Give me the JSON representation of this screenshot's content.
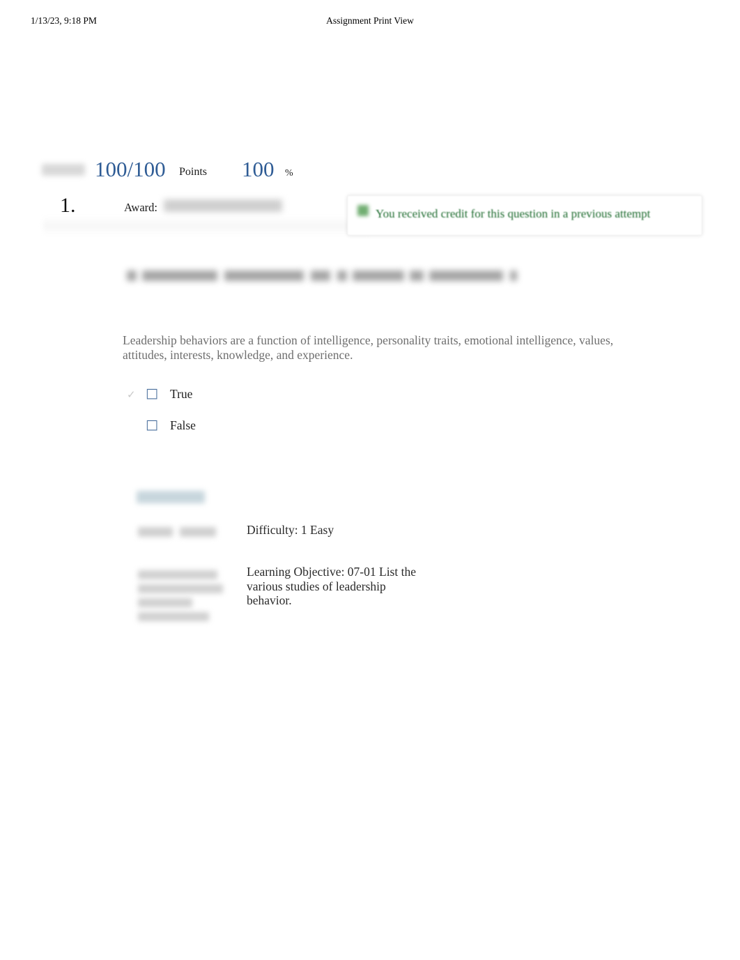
{
  "header": {
    "date": "1/13/23, 9:18 PM",
    "title": "Assignment Print View"
  },
  "score": {
    "points": "100/100",
    "points_label": "Points",
    "percent": "100",
    "percent_label": "%"
  },
  "question": {
    "number": "1.",
    "award_label": "Award:",
    "heading_redacted": "Leadership behaviors are a function of intelligence...",
    "body": "Leadership behaviors are a function of intelligence, personality traits, emotional intelligence, values, attitudes, interests, knowledge, and experience.",
    "choices": [
      {
        "label": "True",
        "selected": true,
        "check_mark": "✓",
        "radio_glyph": "□"
      },
      {
        "label": "False",
        "selected": false,
        "check_mark": "",
        "radio_glyph": "□"
      }
    ]
  },
  "credit_banner": {
    "text": "You received credit for this question in a previous attempt",
    "color": "#1d6b2e",
    "icon_color": "#59a05a"
  },
  "meta": {
    "difficulty": "Difficulty: 1 Easy",
    "learning_objective": "Learning Objective: 07-01 List the various studies of leadership behavior."
  },
  "colors": {
    "score_blue": "#2f5c95",
    "radio_blue": "#4a6f9c",
    "body_gray": "#6e6e6e",
    "refs_blue": "#c7d6dd"
  }
}
